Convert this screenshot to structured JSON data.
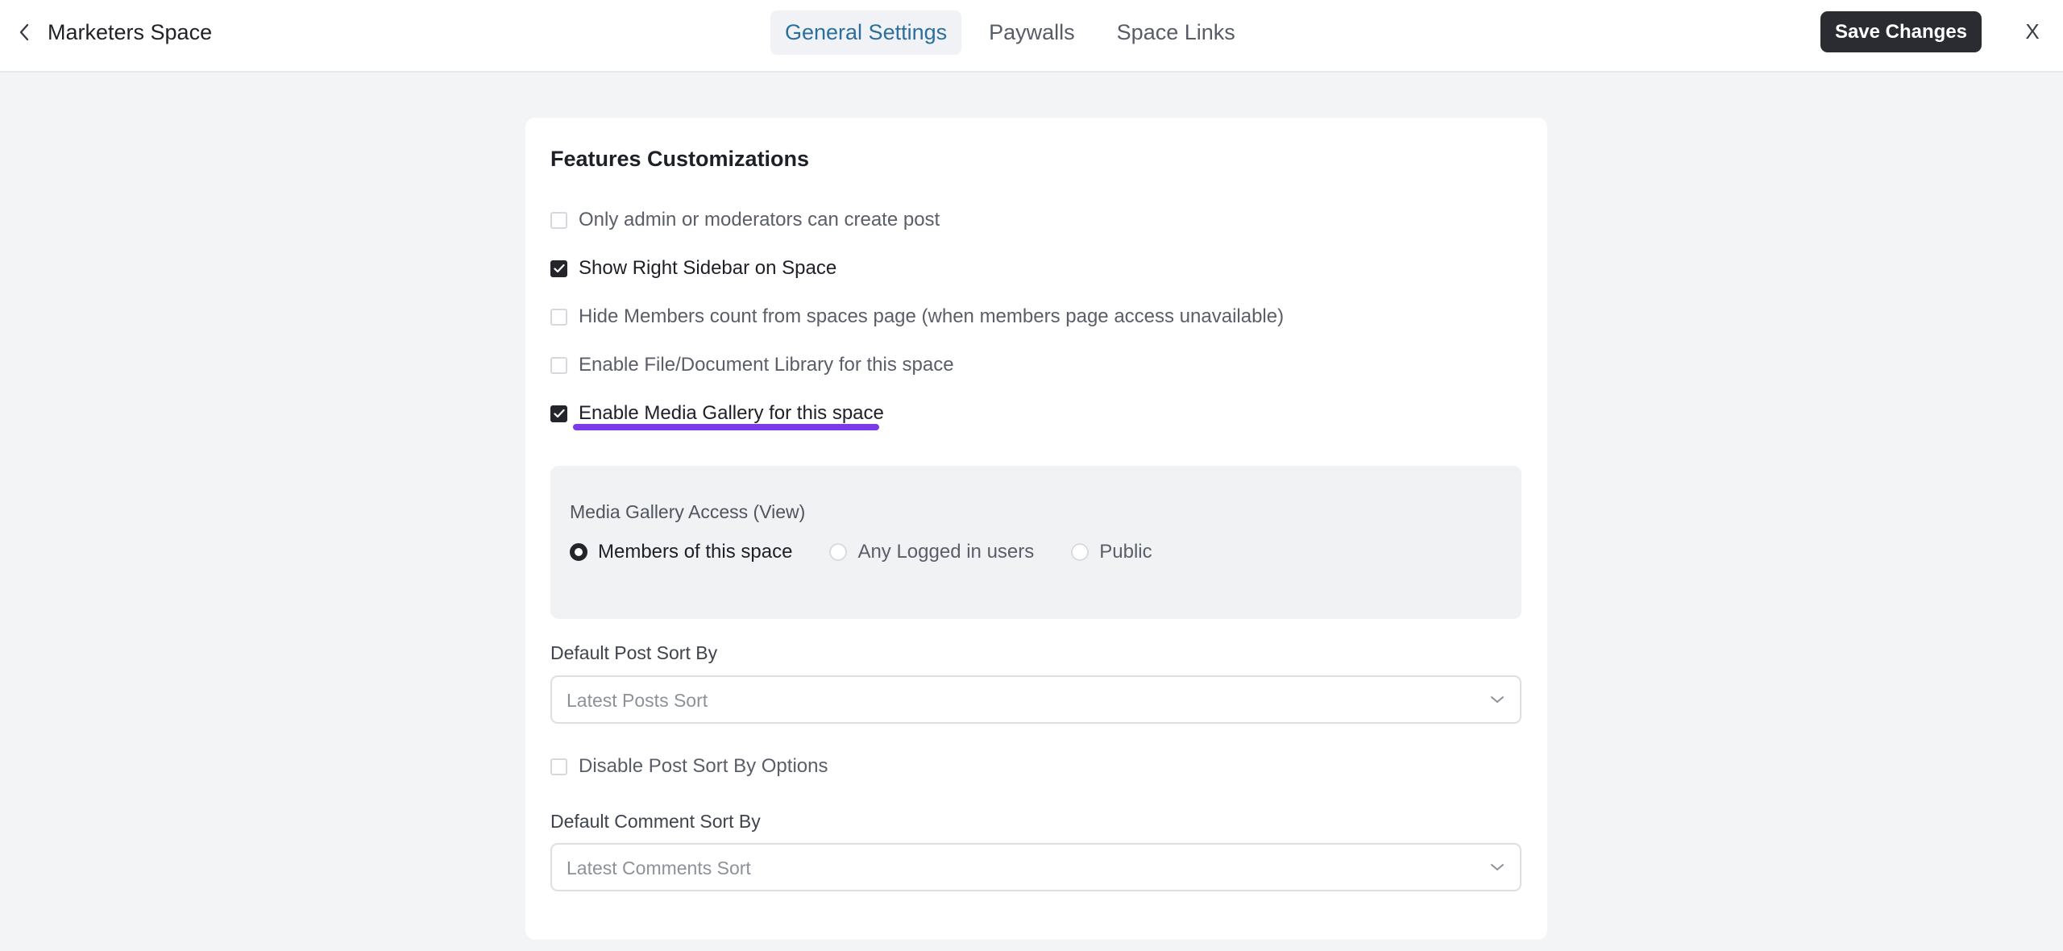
{
  "header": {
    "space_name": "Marketers Space",
    "tabs": [
      {
        "label": "General Settings",
        "active": true
      },
      {
        "label": "Paywalls",
        "active": false
      },
      {
        "label": "Space Links",
        "active": false
      }
    ],
    "save_label": "Save Changes",
    "close_label": "X"
  },
  "features": {
    "title": "Features Customizations",
    "options": [
      {
        "label": "Only admin or moderators can create post",
        "checked": false
      },
      {
        "label": "Show Right Sidebar on Space",
        "checked": true
      },
      {
        "label": "Hide Members count from spaces page (when members page access unavailable)",
        "checked": false
      },
      {
        "label": "Enable File/Document Library for this space",
        "checked": false
      },
      {
        "label": "Enable Media Gallery for this space",
        "checked": true
      }
    ]
  },
  "media_gallery": {
    "label": "Media Gallery Access (View)",
    "options": [
      {
        "label": "Members of this space",
        "selected": true
      },
      {
        "label": "Any Logged in users",
        "selected": false
      },
      {
        "label": "Public",
        "selected": false
      }
    ]
  },
  "post_sort": {
    "label": "Default Post Sort By",
    "placeholder": "Latest Posts Sort"
  },
  "disable_sort": {
    "label": "Disable Post Sort By Options",
    "checked": false
  },
  "comment_sort": {
    "label": "Default Comment Sort By",
    "placeholder": "Latest Comments Sort"
  },
  "colors": {
    "highlight": "#7d3ae8",
    "active_tab_text": "#2b6f9e",
    "primary_button": "#2a2c31"
  }
}
